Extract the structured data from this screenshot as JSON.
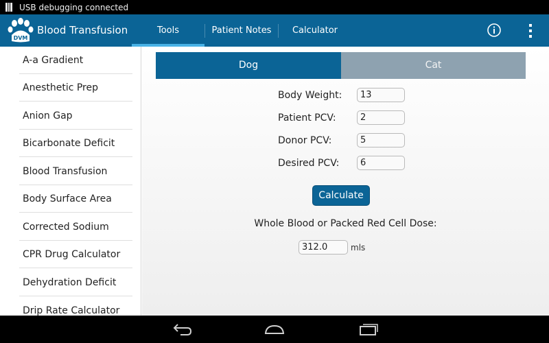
{
  "status_bar": {
    "text": "USB debugging connected"
  },
  "action_bar": {
    "logo_text": "DVM",
    "title": "Blood Transfusion",
    "tabs": [
      {
        "label": "Tools",
        "active": true
      },
      {
        "label": "Patient Notes",
        "active": false
      },
      {
        "label": "Calculator",
        "active": false
      }
    ],
    "info_icon": "info-icon",
    "overflow_icon": "overflow-menu-icon"
  },
  "sidebar": {
    "items": [
      {
        "label": "A-a Gradient"
      },
      {
        "label": "Anesthetic Prep"
      },
      {
        "label": "Anion Gap"
      },
      {
        "label": "Bicarbonate Deficit"
      },
      {
        "label": "Blood Transfusion"
      },
      {
        "label": "Body Surface Area"
      },
      {
        "label": "Corrected Sodium"
      },
      {
        "label": "CPR Drug Calculator"
      },
      {
        "label": "Dehydration Deficit"
      },
      {
        "label": "Drip Rate Calculator"
      }
    ]
  },
  "species": {
    "dog_label": "Dog",
    "cat_label": "Cat",
    "selected": "Dog"
  },
  "form": {
    "fields": [
      {
        "label": "Body Weight:",
        "value": "13"
      },
      {
        "label": "Patient PCV:",
        "value": "2"
      },
      {
        "label": "Donor PCV:",
        "value": "5"
      },
      {
        "label": "Desired PCV:",
        "value": "6"
      }
    ],
    "calculate_label": "Calculate"
  },
  "result": {
    "label": "Whole Blood or Packed Red Cell Dose:",
    "value": "312.0",
    "unit": "mls"
  },
  "nav_bar": {
    "back_icon": "back-icon",
    "home_icon": "home-icon",
    "recents_icon": "recents-icon"
  },
  "colors": {
    "action_bar": "#0b6496",
    "tab_indicator": "#49b2e6",
    "segment_selected": "#0b6496",
    "segment_unselected": "#8ea2b0"
  }
}
